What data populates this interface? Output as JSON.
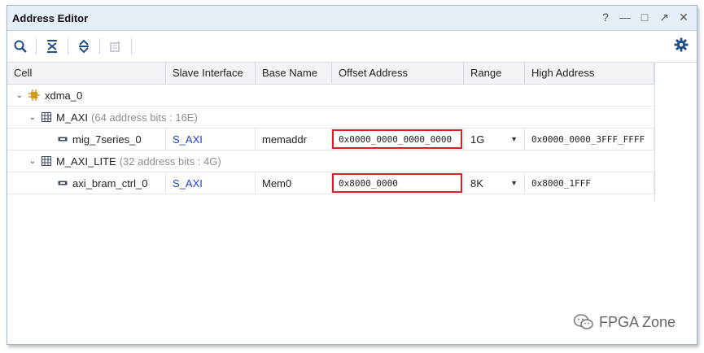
{
  "window": {
    "title": "Address Editor"
  },
  "title_controls": {
    "help": "?",
    "minimize": "—",
    "maximize": "□",
    "float": "↗",
    "close": "✕"
  },
  "toolbar": {
    "buttons": [
      "search-icon",
      "collapse-all-icon",
      "expand-all-icon",
      "auto-assign-icon"
    ],
    "settings": "gear-icon"
  },
  "table": {
    "headers": [
      "Cell",
      "Slave Interface",
      "Base Name",
      "Offset Address",
      "Range",
      "High Address"
    ],
    "root": {
      "name": "xdma_0"
    },
    "groups": [
      {
        "name": "M_AXI",
        "info": "(64 address bits : 16E)",
        "rows": [
          {
            "cell": "mig_7series_0",
            "slave": "S_AXI",
            "base": "memaddr",
            "offset": "0x0000_0000_0000_0000",
            "range": "1G",
            "high": "0x0000_0000_3FFF_FFFF"
          }
        ]
      },
      {
        "name": "M_AXI_LITE",
        "info": "(32 address bits : 4G)",
        "rows": [
          {
            "cell": "axi_bram_ctrl_0",
            "slave": "S_AXI",
            "base": "Mem0",
            "offset": "0x8000_0000",
            "range": "8K",
            "high": "0x8000_1FFF"
          }
        ]
      }
    ]
  },
  "watermark": {
    "text": "FPGA Zone"
  },
  "colors": {
    "title_bg": "#e6eef7",
    "link": "#1a3fd6",
    "highlight": "#e01b24",
    "accent_icon": "#d49b1a"
  }
}
